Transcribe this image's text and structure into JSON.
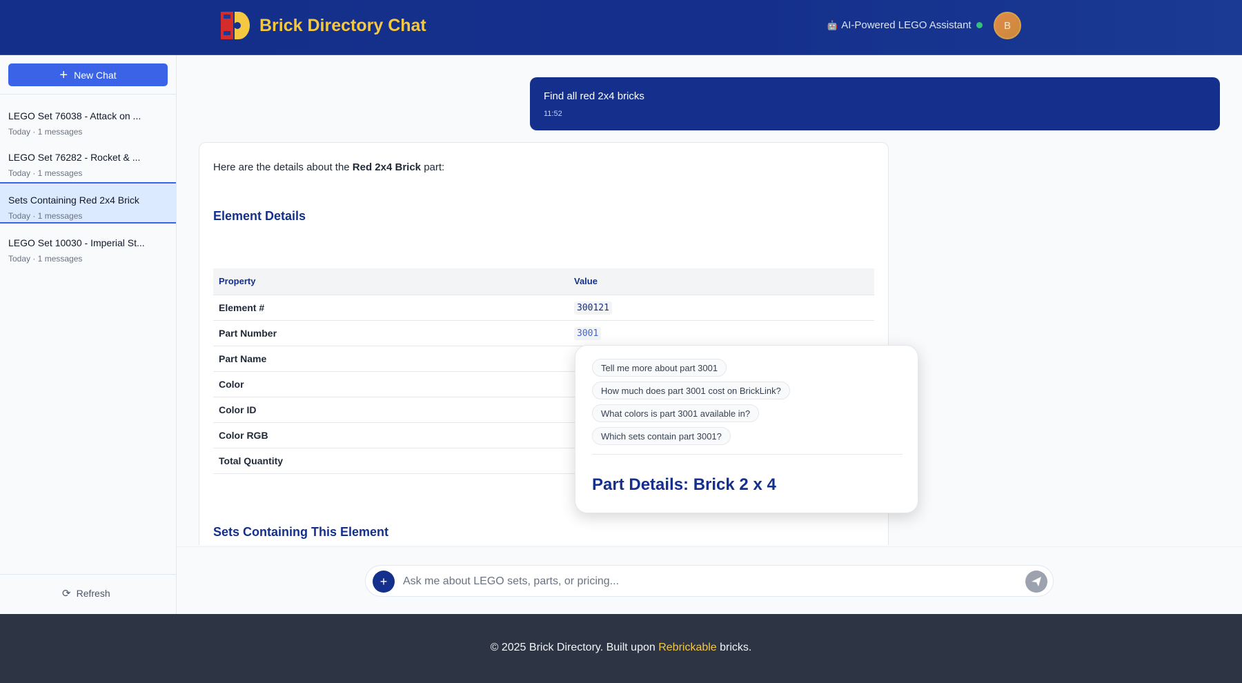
{
  "header": {
    "title": "Brick Directory Chat",
    "assistant_label": "AI-Powered LEGO Assistant",
    "robot_icon": "🤖",
    "avatar_initial": "B"
  },
  "sidebar": {
    "new_chat_label": "New Chat",
    "items": [
      {
        "title": "LEGO Set 76038 - Attack on ...",
        "subtitle": "Today · 1 messages"
      },
      {
        "title": "LEGO Set 76282 - Rocket & ...",
        "subtitle": "Today · 1 messages"
      },
      {
        "title": "Sets Containing Red 2x4 Brick",
        "subtitle": "Today · 1 messages"
      },
      {
        "title": "LEGO Set 10030 - Imperial St...",
        "subtitle": "Today · 1 messages"
      }
    ],
    "refresh_label": "Refresh"
  },
  "conversation": {
    "user_message": "Find all red 2x4 bricks",
    "user_time": "11:52",
    "bot": {
      "intro_prefix": "Here are the details about the ",
      "intro_bold": "Red 2x4 Brick",
      "intro_suffix": " part:",
      "section1": "Element Details",
      "table_headers": [
        "Property",
        "Value"
      ],
      "rows": [
        {
          "property": "Element #",
          "value": "300121"
        },
        {
          "property": "Part Number",
          "value": "3001"
        },
        {
          "property": "Part Name",
          "value": ""
        },
        {
          "property": "Color",
          "value": ""
        },
        {
          "property": "Color ID",
          "value": ""
        },
        {
          "property": "Color RGB",
          "value": ""
        },
        {
          "property": "Total Quantity",
          "value": ""
        }
      ],
      "section2": "Sets Containing This Element"
    }
  },
  "popover": {
    "suggestions": [
      "Tell me more about part 3001",
      "How much does part 3001 cost on BrickLink?",
      "What colors is part 3001 available in?",
      "Which sets contain part 3001?"
    ],
    "title": "Part Details: Brick 2 x 4"
  },
  "input": {
    "placeholder": "Ask me about LEGO sets, parts, or pricing..."
  },
  "footer": {
    "prefix": "© 2025 Brick Directory. Built upon ",
    "highlight": "Rebrickable",
    "suffix": " bricks."
  },
  "colors": {
    "brand_blue": "#14308c",
    "accent_yellow": "#f5c842",
    "button_blue": "#3a63e8"
  }
}
